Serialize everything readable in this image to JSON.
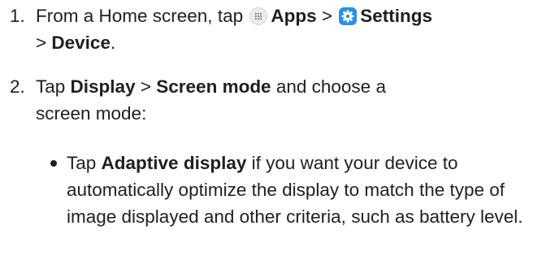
{
  "steps": [
    {
      "number": "1.",
      "prefix": "From a Home screen, tap",
      "apps_label": "Apps",
      "sep1": ">",
      "settings_label": "Settings",
      "sep2": ">",
      "device_label": "Device",
      "end": "."
    },
    {
      "number": "2.",
      "prefix": "Tap",
      "display_label": "Display",
      "sep": ">",
      "screen_mode_label": "Screen mode",
      "suffix": "and choose a screen mode:"
    }
  ],
  "bullets": [
    {
      "prefix": "Tap",
      "bold": "Adaptive display",
      "suffix": "if you want your device to automatically optimize the display to match the type of image displayed and other criteria, such as battery level."
    }
  ],
  "icons": {
    "apps": "apps-grid-icon",
    "settings": "gear-icon"
  },
  "colors": {
    "text": "#1f1f1f",
    "settings_icon_bg": "#2f8fdc",
    "apps_icon_bg": "#ececec"
  }
}
